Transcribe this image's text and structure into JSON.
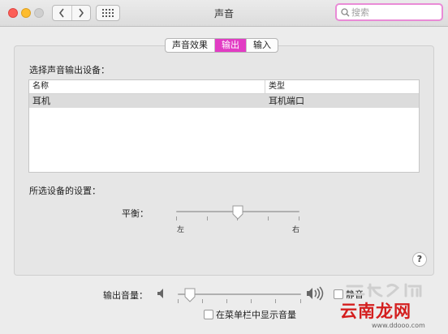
{
  "window": {
    "title": "声音"
  },
  "search": {
    "placeholder": "搜索"
  },
  "tabs": [
    {
      "label": "声音效果",
      "active": false
    },
    {
      "label": "输出",
      "active": true
    },
    {
      "label": "输入",
      "active": false
    }
  ],
  "output": {
    "section_title": "选择声音输出设备：",
    "table": {
      "columns": [
        "名称",
        "类型"
      ],
      "rows": [
        {
          "name": "耳机",
          "type": "耳机端口",
          "selected": true
        }
      ]
    },
    "settings_title": "所选设备的设置：",
    "balance": {
      "label": "平衡：",
      "left_label": "左",
      "right_label": "右",
      "value": 0.5
    }
  },
  "help": {
    "label": "?"
  },
  "volume": {
    "label": "输出音量：",
    "value": 0.1,
    "mute_label": "静音",
    "mute_checked": false,
    "show_in_menubar_label": "在菜单栏中显示音量",
    "show_in_menubar_checked": false
  },
  "watermark": {
    "text": "云南龙网",
    "url": "www.ddooo.com"
  },
  "colors": {
    "accent": "#e23cc4",
    "search_ring": "#e98bd6",
    "watermark": "#d41e1e"
  },
  "icons": [
    "back-chevron-icon",
    "forward-chevron-icon",
    "grid-icon",
    "search-icon",
    "speaker-low-icon",
    "speaker-high-icon"
  ]
}
